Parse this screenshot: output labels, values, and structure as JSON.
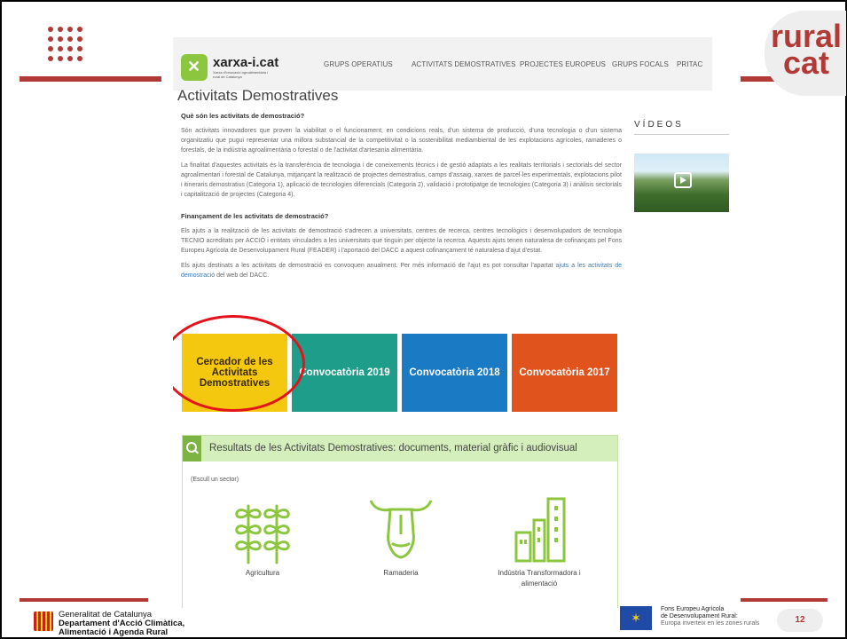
{
  "slide": {
    "brand_badge": "rural cat",
    "page_number": "12",
    "accent_color": "#b23a36"
  },
  "site": {
    "logo_name": "xarxa-i.cat",
    "logo_tagline": "Xarxa d'innovació agroalimentària i rural de Catalunya",
    "nav": [
      "GRUPS OPERATIUS",
      "ACTIVITATS DEMOSTRATIVES",
      "PROJECTES EUROPEUS",
      "GRUPS FOCALS",
      "PRITAC"
    ]
  },
  "main": {
    "title": "Activitats Demostratives",
    "q1": "Què són les activitats de demostració?",
    "p1": "Són activitats innovadores que proven la viabilitat o el funcionament, en condicions reals, d'un sistema de producció, d'una tecnologia o d'un sistema organitzatiu que pugui representar una millora substancial de la competitivitat o la sostenibilitat mediambiental de les explotacions agrícoles, ramaderes o forestals, de la indústria agroalimentària o forestal o de l'activitat d'artesania alimentària.",
    "p2": "La finalitat d'aquestes activitats és la transferència de tecnologia i de coneixements tècnics i de gestió adaptats a les realitats territorials i sectorials del sector agroalimentari i forestal de Catalunya, mitjançant la realització de projectes demostratius, camps d'assaig, xarxes de parcel·les experimentals, explotacions pilot i itineraris demostratius (Categoria 1), aplicació de tecnologies diferencials (Categoria 2), validació i prototipatge de tecnologies (Categoria 3) i anàlisis sectorials i capitalització de projectes (Categoria 4).",
    "q2": "Finançament de les activitats de demostració?",
    "p3": "Els ajuts a la realització de les activitats de demostració s'adrecen a universitats, centres de recerca, centres tecnològics i desenvolupadors de tecnologia TECNIO acreditats per ACCIÓ i entitats vinculades a les universitats que tinguin per objecte la recerca. Aquests ajuts tenen naturalesa de cofinançats pel Fons Europeu Agrícola de Desenvolupament Rural (FEADER) i l'aportació del DACC a aquest cofinançament té naturalesa d'ajut d'estat.",
    "p4_start": "Els ajuts destinats a les activitats de demostració es convoquen anualment. Per més informació de l'ajut es pot consultar l'apartat ",
    "p4_link": "ajuts a les activitats de demostració",
    "p4_end": " del web del DACC."
  },
  "sidebar": {
    "title": "VÍDEOS"
  },
  "tiles": [
    {
      "label": "Cercador de les Activitats Demostratives",
      "color": "#f3c80f"
    },
    {
      "label": "Convocatòria 2019",
      "color": "#1e9e8a"
    },
    {
      "label": "Convocatòria 2018",
      "color": "#1a7ac4"
    },
    {
      "label": "Convocatòria 2017",
      "color": "#e0531d"
    }
  ],
  "results": {
    "title": "Resultats de les Activitats Demostratives: documents, material gràfic i audiovisual",
    "hint": "(Escull un sector)",
    "sectors": [
      {
        "label": "Agricultura",
        "icon": "plants-icon"
      },
      {
        "label": "Ramaderia",
        "icon": "cow-icon"
      },
      {
        "label": "Indústria Transformadora i alimentació",
        "icon": "factory-icon"
      }
    ]
  },
  "footer": {
    "gen_line1": "Generalitat de Catalunya",
    "gen_line2": "Departament d'Acció Climàtica,",
    "gen_line3": "Alimentació i Agenda Rural",
    "feader_line1": "Fons Europeu Agrícola",
    "feader_line2": "de Desenvolupament Rural:",
    "feader_line3": "Europa inverteix en les zones rurals"
  }
}
